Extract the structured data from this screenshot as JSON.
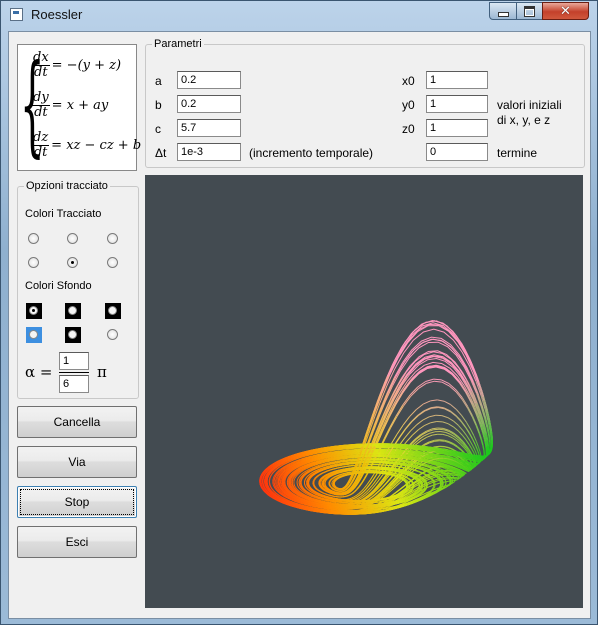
{
  "window": {
    "title": "Roessler"
  },
  "titlebar": {
    "close_glyph": "✕"
  },
  "equations": [
    {
      "num": "dx",
      "den": "dt",
      "rhs": "= −(y + z)"
    },
    {
      "num": "dy",
      "den": "dt",
      "rhs": "= x + ay"
    },
    {
      "num": "dz",
      "den": "dt",
      "rhs": "= xz − cz + b"
    }
  ],
  "params": {
    "legend": "Parametri",
    "a_label": "a",
    "a_value": "0.2",
    "b_label": "b",
    "b_value": "0.2",
    "c_label": "c",
    "c_value": "5.7",
    "dt_label": "Δt",
    "dt_value": "1e-3",
    "dt_note": "(incremento temporale)",
    "x0_label": "x0",
    "x0_value": "1",
    "y0_label": "y0",
    "y0_value": "1",
    "z0_label": "z0",
    "z0_value": "1",
    "initial_note_1": "valori iniziali",
    "initial_note_2": "di x, y, e z",
    "end_value": "0",
    "end_label": "termine"
  },
  "plot_options": {
    "legend": "Opzioni tracciato",
    "trace_colors_label": "Colori Tracciato",
    "trace_selected_index": 4,
    "background_label": "Colori Sfondo",
    "background_selected_index": 0,
    "background_swatches": [
      "#000000",
      "#000000",
      "#000000",
      "#3d8fe0",
      "#000000",
      "#f0f0f0"
    ],
    "alpha_label": "α =",
    "alpha_num": "1",
    "alpha_den": "6",
    "pi_label": "π"
  },
  "buttons": {
    "clear": "Cancella",
    "go": "Via",
    "stop": "Stop",
    "exit": "Esci"
  },
  "canvas": {
    "background": "#434b51"
  }
}
